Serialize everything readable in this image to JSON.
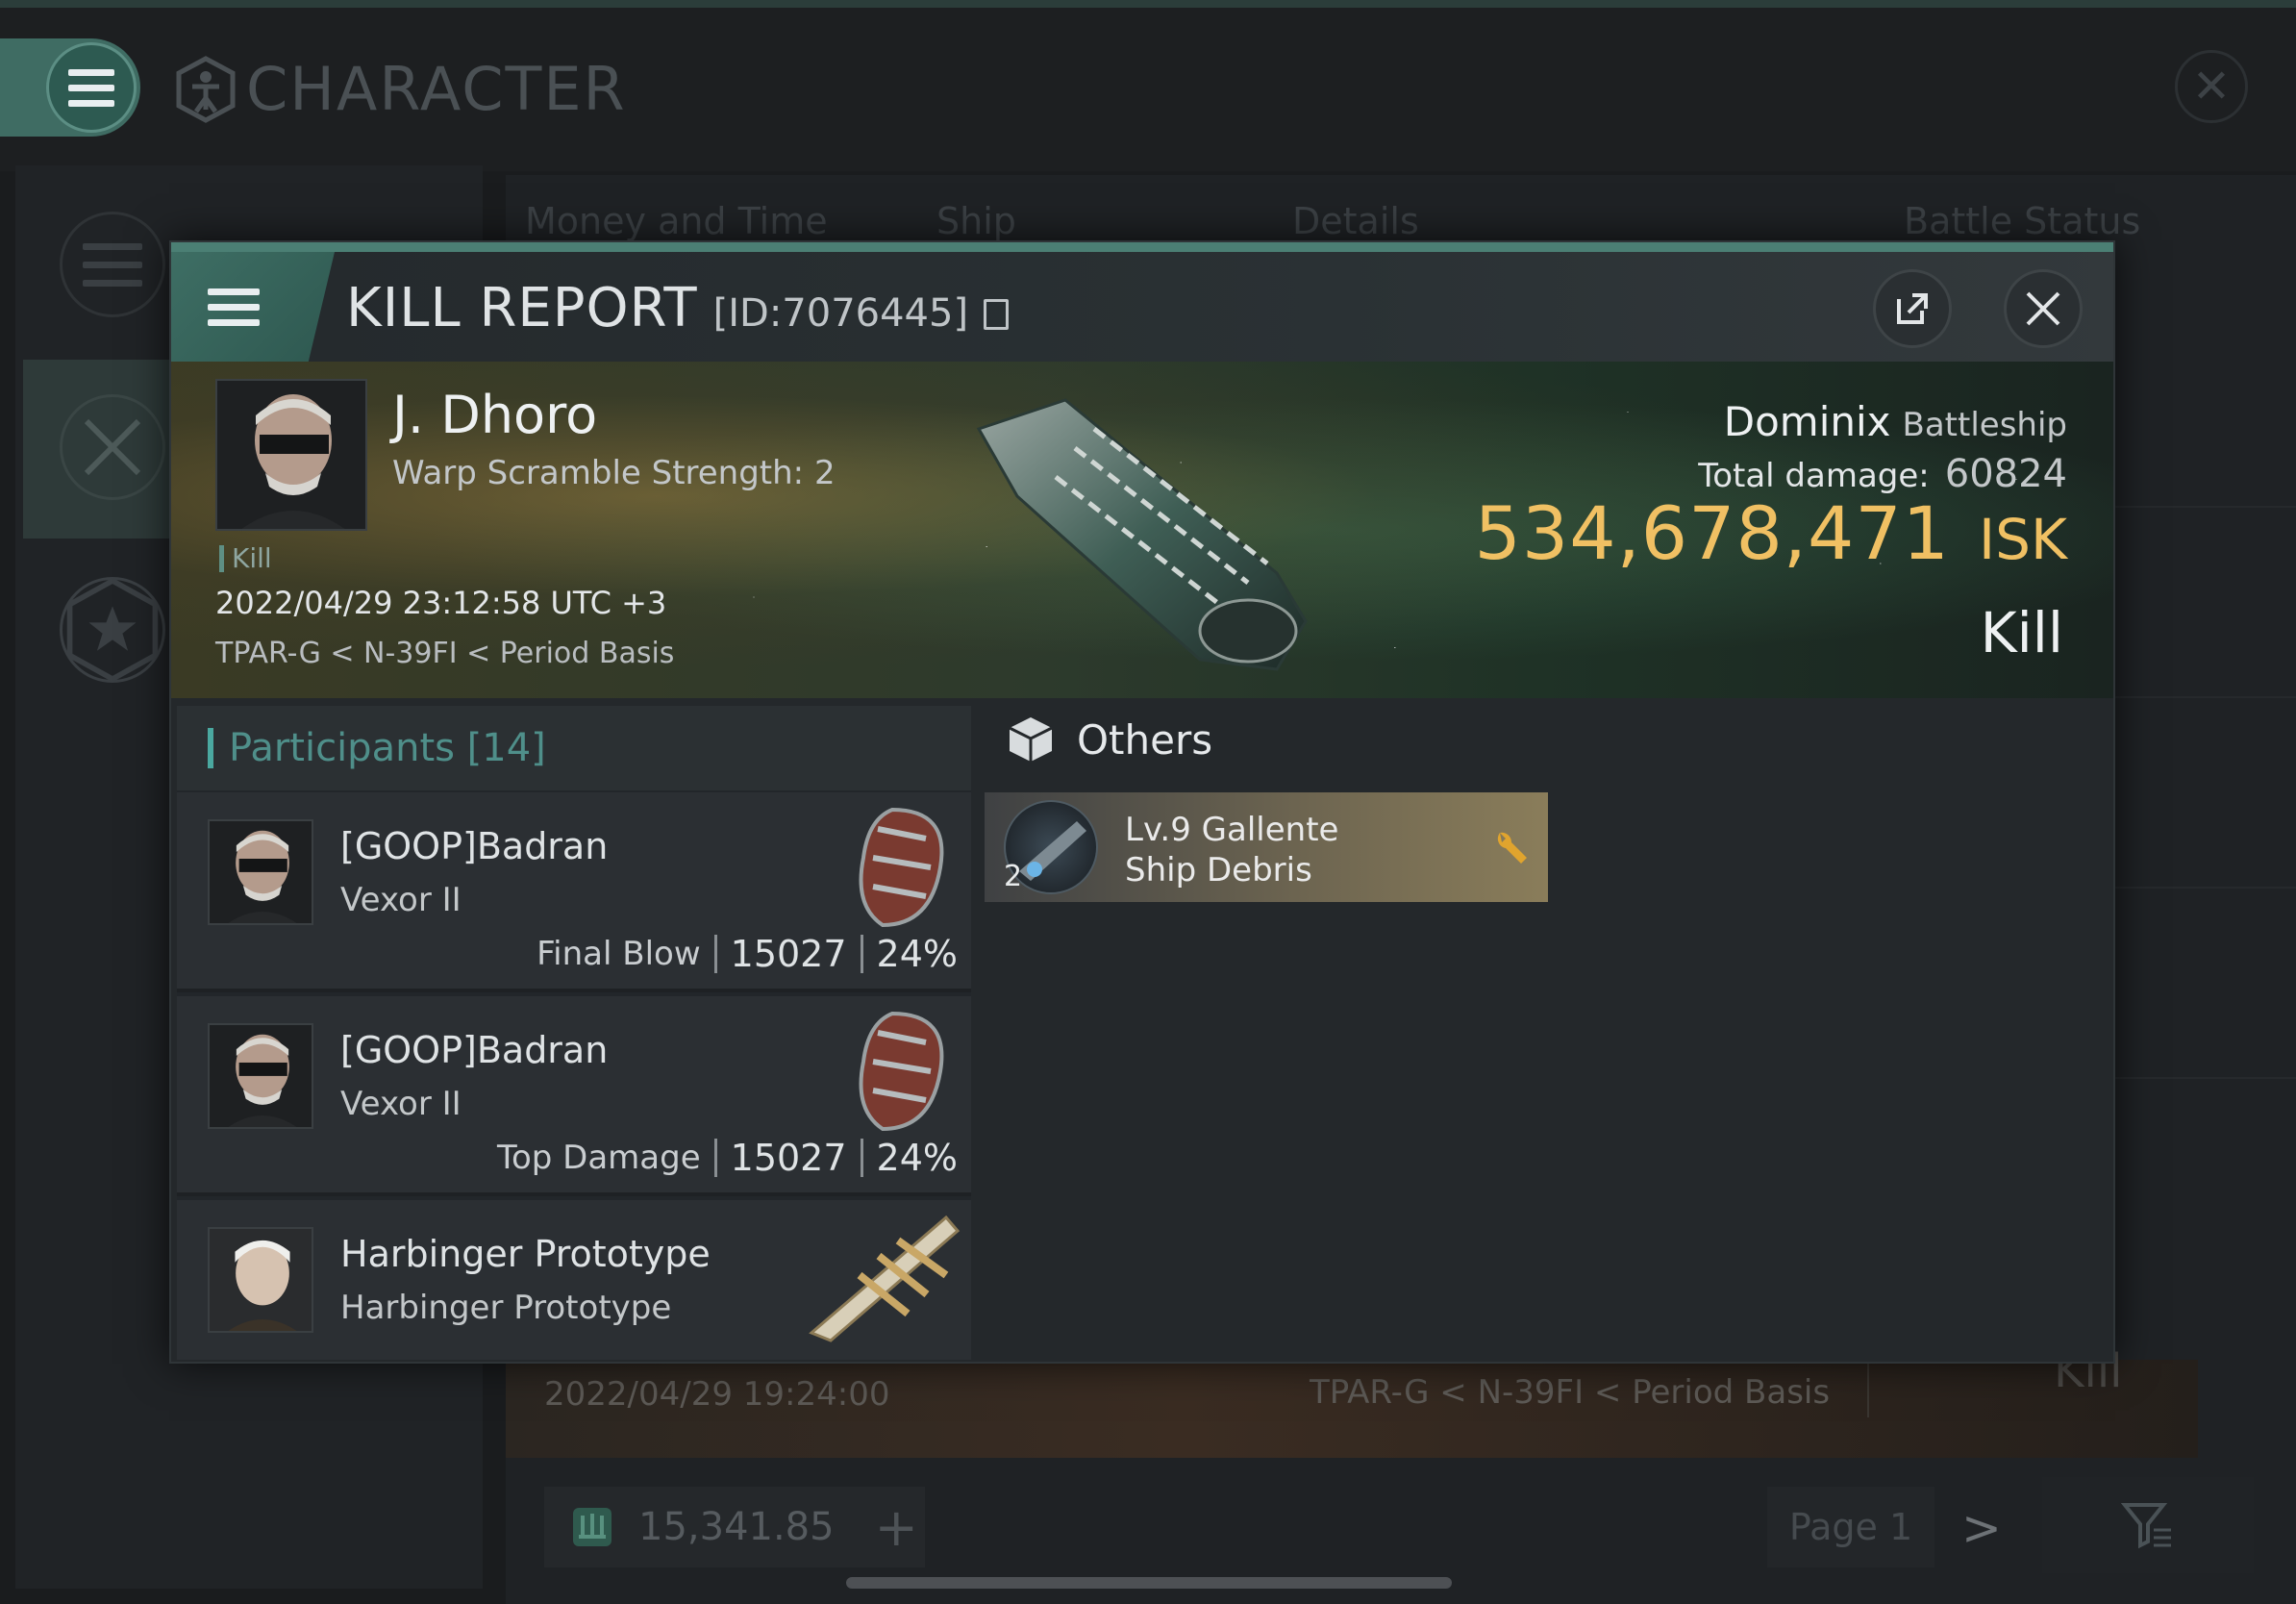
{
  "background": {
    "title": "CHARACTER",
    "tabs": [
      "Money and Time",
      "Ship",
      "Details",
      "Battle Status"
    ],
    "bottom_card": {
      "date": "2022/04/29 19:24:00",
      "location": "TPAR-G < N-39FI < Period Basis",
      "result": "Kill"
    },
    "footer": {
      "isk": "15,341.85",
      "plus": "+",
      "page": "Page 1",
      "next": ">"
    }
  },
  "modal": {
    "title": "KILL REPORT",
    "id": "[ID:7076445]",
    "victim": {
      "name": "J. Dhoro",
      "warp_scramble": "Warp Scramble Strength: 2",
      "tag": "Kill",
      "datetime": "2022/04/29 23:12:58 UTC +3",
      "location": "TPAR-G < N-39FI < Period Basis",
      "ship_name": "Dominix",
      "ship_class": "Battleship",
      "total_damage_label": "Total damage:",
      "total_damage": "60824",
      "isk_value": "534,678,471",
      "isk_unit": "ISK",
      "result": "Kill"
    },
    "participants": {
      "header": "Participants [14]",
      "items": [
        {
          "name": "[GOOP]Badran",
          "ship": "Vexor II",
          "label": "Final Blow",
          "damage": "15027",
          "percent": "24%"
        },
        {
          "name": "[GOOP]Badran",
          "ship": "Vexor II",
          "label": "Top Damage",
          "damage": "15027",
          "percent": "24%"
        },
        {
          "name": "Harbinger Prototype",
          "ship": "Harbinger Prototype"
        }
      ]
    },
    "others": {
      "header": "Others",
      "items": [
        {
          "name": "Lv.9 Gallente Ship Debris",
          "count": "2"
        }
      ]
    }
  },
  "colors": {
    "accent_teal": "#4b7f74",
    "isk_gold": "#f0c063",
    "participants_header": "#4f8f8a"
  }
}
